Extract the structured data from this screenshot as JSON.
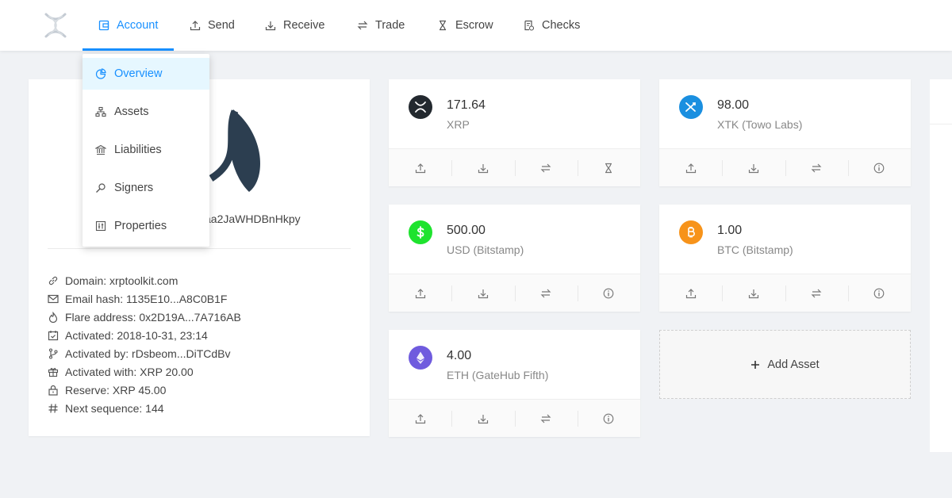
{
  "nav": {
    "items": [
      {
        "label": "Account",
        "icon": "wallet-icon",
        "active": true
      },
      {
        "label": "Send",
        "icon": "upload-icon"
      },
      {
        "label": "Receive",
        "icon": "download-icon"
      },
      {
        "label": "Trade",
        "icon": "swap-icon"
      },
      {
        "label": "Escrow",
        "icon": "hourglass-icon"
      },
      {
        "label": "Checks",
        "icon": "check-document-icon"
      }
    ]
  },
  "account_menu": {
    "items": [
      {
        "label": "Overview",
        "icon": "pie-chart-icon",
        "selected": true
      },
      {
        "label": "Assets",
        "icon": "cluster-icon"
      },
      {
        "label": "Liabilities",
        "icon": "bank-icon"
      },
      {
        "label": "Signers",
        "icon": "key-icon"
      },
      {
        "label": "Properties",
        "icon": "sliders-icon"
      }
    ]
  },
  "account": {
    "address_visible": "aa2JaWHDBnHkpy",
    "info": [
      {
        "icon": "link-icon",
        "text": "Domain: xrptoolkit.com"
      },
      {
        "icon": "mail-icon",
        "text": "Email hash: 1135E10...A8C0B1F"
      },
      {
        "icon": "flame-icon",
        "text": "Flare address: 0x2D19A...7A716AB"
      },
      {
        "icon": "calendar-check-icon",
        "text": "Activated: 2018-10-31, 23:14"
      },
      {
        "icon": "branch-icon",
        "text": "Activated by: rDsbeom...DiTCdBv"
      },
      {
        "icon": "gift-icon",
        "text": "Activated with: XRP 20.00"
      },
      {
        "icon": "lock-icon",
        "text": "Reserve: XRP 45.00"
      },
      {
        "icon": "hash-icon",
        "text": "Next sequence: 144"
      }
    ]
  },
  "assets": [
    {
      "amount": "171.64",
      "name": "XRP",
      "icon": "xrp-coin-icon",
      "color": "#23292f",
      "actions": [
        "send",
        "receive",
        "trade",
        "escrow"
      ]
    },
    {
      "amount": "98.00",
      "name": "XTK (Towo Labs)",
      "icon": "xtk-coin-icon",
      "color": "#1a8fe0",
      "actions": [
        "send",
        "receive",
        "trade",
        "info"
      ]
    },
    {
      "amount": "500.00",
      "name": "USD (Bitstamp)",
      "icon": "usd-coin-icon",
      "color": "#1ee32e",
      "actions": [
        "send",
        "receive",
        "trade",
        "info"
      ]
    },
    {
      "amount": "1.00",
      "name": "BTC (Bitstamp)",
      "icon": "btc-coin-icon",
      "color": "#f7931a",
      "actions": [
        "send",
        "receive",
        "trade",
        "info"
      ]
    },
    {
      "amount": "4.00",
      "name": "ETH (GateHub Fifth)",
      "icon": "eth-coin-icon",
      "color": "#6f5bde",
      "actions": [
        "send",
        "receive",
        "trade",
        "info"
      ]
    }
  ],
  "add_asset": {
    "label": "Add Asset"
  },
  "colors": {
    "accent": "#1890ff",
    "selected_bg": "#e6f7ff"
  }
}
